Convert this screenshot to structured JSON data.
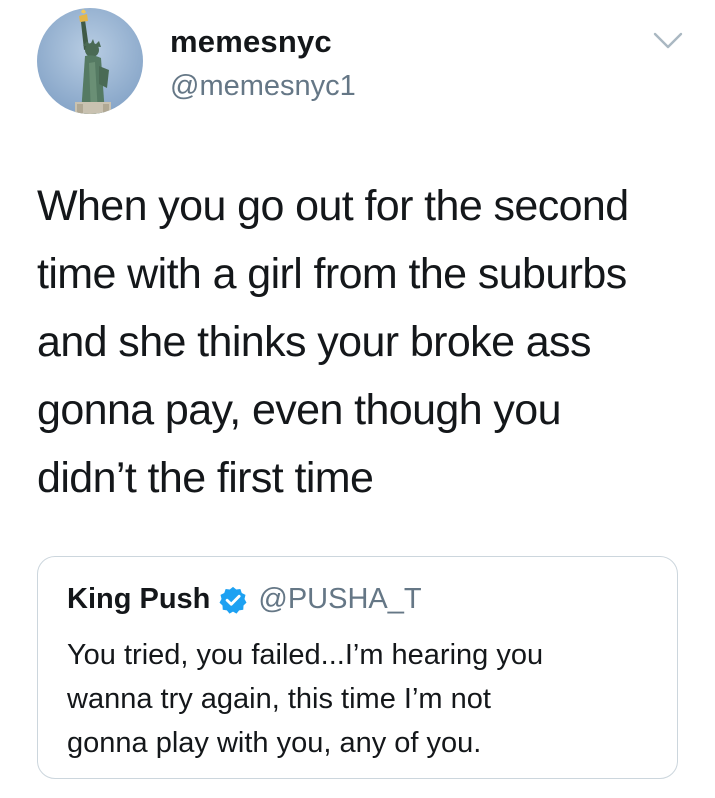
{
  "tweet": {
    "author_name": "memesnyc",
    "author_handle": "@memesnyc1",
    "text_lines": [
      "When you go out for the second",
      "time with a girl from the suburbs",
      "and she thinks your broke ass",
      "gonna pay, even though you",
      "didn’t the first time"
    ]
  },
  "quoted_tweet": {
    "author_name": "King Push",
    "author_handle": "@PUSHA_T",
    "text_lines": [
      "You tried, you failed...I’m hearing you",
      "wanna try again, this time I’m not",
      "gonna play with you, any of you."
    ]
  },
  "icons": {
    "menu": "chevron-down-icon",
    "verified": "verified-badge-icon",
    "avatar": "statue-of-liberty-avatar"
  },
  "colors": {
    "text": "#14171a",
    "secondary_text": "#657786",
    "verified_blue": "#1da1f2",
    "border": "#ccd6dd"
  }
}
